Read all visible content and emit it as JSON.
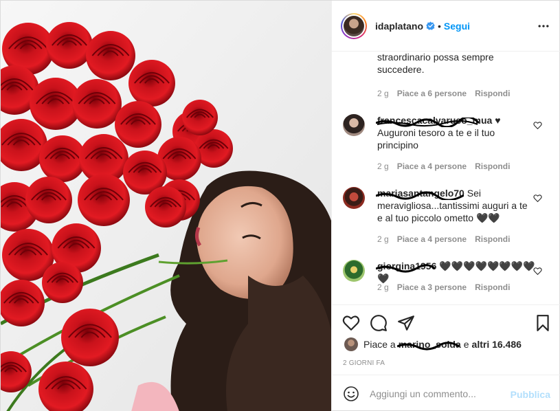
{
  "header": {
    "username": "idaplatano",
    "separator": "•",
    "follow_label": "Segui"
  },
  "comments": [
    {
      "text": "straordinario possa sempre succedere.",
      "time": "2 g",
      "likes": "Piace a 6 persone",
      "reply": "Rispondi"
    },
    {
      "user": "francescacalvaruso_mua",
      "user_suffix": "♥",
      "text": "Auguroni tesoro a te e il tuo principino",
      "time": "2 g",
      "likes": "Piace a 4 persone",
      "reply": "Rispondi"
    },
    {
      "user": "mariasantangelo70",
      "text": "Sei meravigliosa...tantissimi auguri a te e al tuo piccolo ometto 🖤🖤",
      "time": "2 g",
      "likes": "Piace a 4 persone",
      "reply": "Rispondi"
    },
    {
      "user": "giorgina1956",
      "text": "🖤🖤🖤🖤🖤🖤🖤🖤🖤",
      "time": "2 g",
      "likes": "Piace a 3 persone",
      "reply": "Rispondi"
    }
  ],
  "likes": {
    "prefix": "Piace a",
    "user": "marino_solda",
    "middle": "e",
    "others": "altri 16.486"
  },
  "posted_ago": "2 GIORNI FA",
  "add_comment": {
    "placeholder": "Aggiungi un commento...",
    "publish_label": "Pubblica"
  },
  "icons": {
    "verified": "verified-badge-icon",
    "more": "more-options-icon",
    "like": "heart-icon",
    "comment": "comment-bubble-icon",
    "share": "paper-plane-icon",
    "save": "bookmark-icon",
    "emoji": "smiley-icon"
  },
  "colors": {
    "accent": "#0095f6",
    "publish_disabled": "#b2dffc",
    "muted": "#8e8e8e",
    "rose": "#c8101a"
  }
}
